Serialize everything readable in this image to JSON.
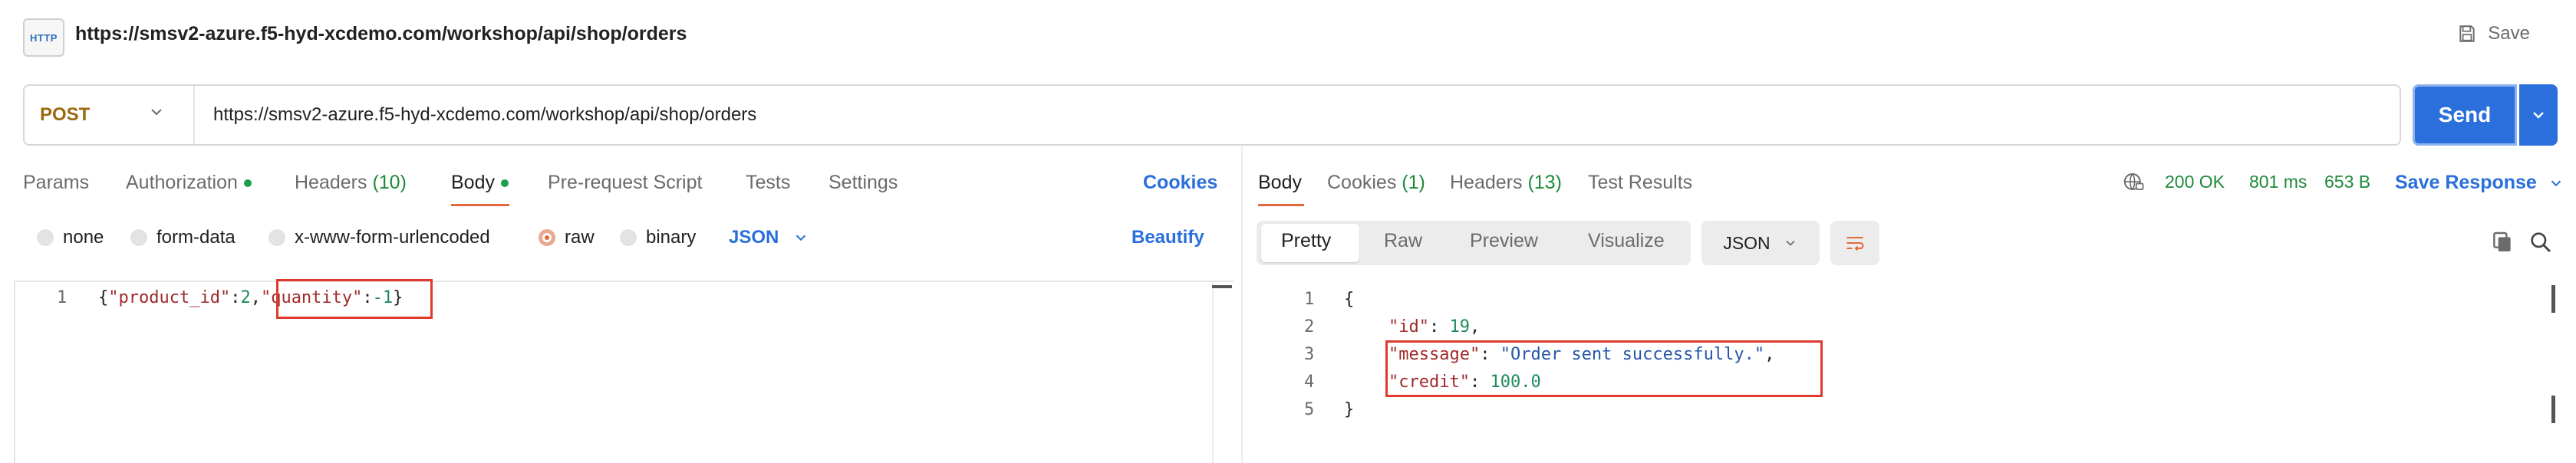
{
  "header": {
    "icon_label": "HTTP",
    "title": "https://smsv2-azure.f5-hyd-xcdemo.com/workshop/api/shop/orders",
    "save_label": "Save"
  },
  "request": {
    "method": "POST",
    "url": "https://smsv2-azure.f5-hyd-xcdemo.com/workshop/api/shop/orders",
    "send_label": "Send"
  },
  "request_tabs": {
    "params": "Params",
    "authorization": "Authorization",
    "headers": "Headers",
    "headers_count": "(10)",
    "body": "Body",
    "prerequest": "Pre-request Script",
    "tests": "Tests",
    "settings": "Settings",
    "cookies": "Cookies"
  },
  "body_options": {
    "none": "none",
    "form_data": "form-data",
    "urlencoded": "x-www-form-urlencoded",
    "raw": "raw",
    "binary": "binary",
    "format": "JSON",
    "beautify": "Beautify",
    "selected": "raw"
  },
  "request_body": {
    "line_number": "1",
    "open": "{",
    "key1": "\"product_id\"",
    "colon1": ":",
    "val1": "2",
    "comma1": ",",
    "key2": "\"quantity\"",
    "colon2": ":",
    "val2": "-1",
    "close": "}"
  },
  "response_tabs": {
    "body": "Body",
    "cookies": "Cookies",
    "cookies_count": "(1)",
    "headers": "Headers",
    "headers_count": "(13)",
    "test_results": "Test Results"
  },
  "response_meta": {
    "status": "200 OK",
    "time": "801 ms",
    "size": "653 B",
    "save_response": "Save Response"
  },
  "view_modes": {
    "pretty": "Pretty",
    "raw": "Raw",
    "preview": "Preview",
    "visualize": "Visualize",
    "format": "JSON"
  },
  "response_body": {
    "ln1": "1",
    "ln2": "2",
    "ln3": "3",
    "ln4": "4",
    "ln5": "5",
    "open": "{",
    "id_key": "\"id\"",
    "id_sep": ": ",
    "id_val": "19",
    "id_comma": ",",
    "msg_key": "\"message\"",
    "msg_sep": ": ",
    "msg_val": "\"Order sent successfully.\"",
    "msg_comma": ",",
    "credit_key": "\"credit\"",
    "credit_sep": ": ",
    "credit_val": "100.0",
    "close": "}"
  },
  "colors": {
    "accent": "#2a6fdc",
    "method": "#9a6a12",
    "active_underline": "#e46a3a",
    "success": "#1f8a3a",
    "highlight_box": "#e03a2e"
  }
}
